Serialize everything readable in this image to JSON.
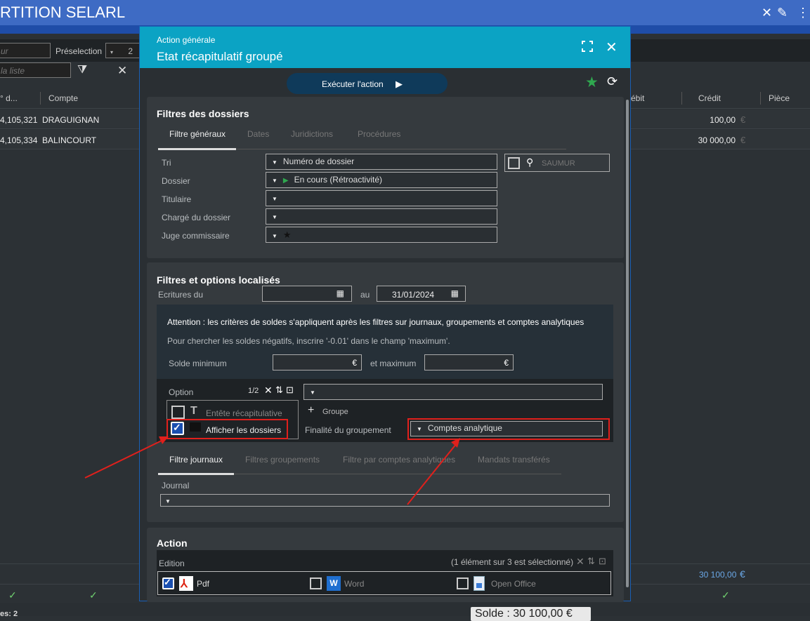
{
  "app": {
    "title": "RTITION SELARL"
  },
  "bg": {
    "toolbar": {
      "preselection_label": "Préselection",
      "search_placeholder": "la liste",
      "first_placeholder": "ur",
      "presel_value": "2"
    },
    "headers": {
      "n": "° d...",
      "compte": "Compte",
      "debit": "ébit",
      "credit": "Crédit",
      "piece": "Pièce"
    },
    "rows": [
      {
        "n": "4,105,321",
        "compte": "DRAGUIGNAN",
        "credit": "100,00",
        "cur": "€"
      },
      {
        "n": "4,105,334",
        "compte": "BALINCOURT",
        "credit": "30 000,00",
        "cur": "€"
      }
    ],
    "total": "30 100,00",
    "total_cur": "€",
    "footer_count": "es: 2",
    "solde": "Solde : 30 100,00 €"
  },
  "modal": {
    "subtitle": "Action générale",
    "title": "Etat récapitulatif groupé",
    "execute_label": "Exécuter l'action",
    "filtres_dossiers": {
      "title": "Filtres des dossiers",
      "tabs": [
        "Filtre généraux",
        "Dates",
        "Juridictions",
        "Procédures"
      ],
      "tri_label": "Tri",
      "tri_value": "Numéro de dossier",
      "dossier_label": "Dossier",
      "dossier_value": "En cours (Rétroactivité)",
      "titulaire_label": "Titulaire",
      "charge_label": "Chargé du dossier",
      "juge_label": "Juge commissaire",
      "location": "SAUMUR"
    },
    "filtres_options": {
      "title": "Filtres et options localisés",
      "ecritures_label": "Ecritures du",
      "au_label": "au",
      "date_to": "31/01/2024",
      "warning": "Attention : les critères de soldes s'appliquent après les filtres sur journaux, groupements et comptes analytiques",
      "hint": "Pour chercher les soldes négatifs, inscrire '-0.01' dans le champ 'maximum'.",
      "solde_min_label": "Solde minimum",
      "et_max_label": "et maximum",
      "cur": "€",
      "option_label": "Option",
      "option_count": "1/2",
      "entete_label": "Entête récapitulative",
      "afficher_label": "Afficher les dossiers",
      "groupe_label": "Groupe",
      "finalite_label": "Finalité du groupement",
      "finalite_value": "Comptes analytique",
      "tabs": [
        "Filtre journaux",
        "Filtres groupements",
        "Filtre par comptes analytiques",
        "Mandats transférés"
      ],
      "journal_label": "Journal"
    },
    "action": {
      "title": "Action",
      "edition_label": "Edition",
      "selected_info": "(1 élément sur 3 est sélectionné)",
      "pdf": "Pdf",
      "word": "Word",
      "openoffice": "Open Office"
    }
  },
  "colors": {
    "header": "#0ba3c4",
    "topbar": "#3e6bc4",
    "highlight": "#e0201c",
    "star": "#2fa84f"
  }
}
